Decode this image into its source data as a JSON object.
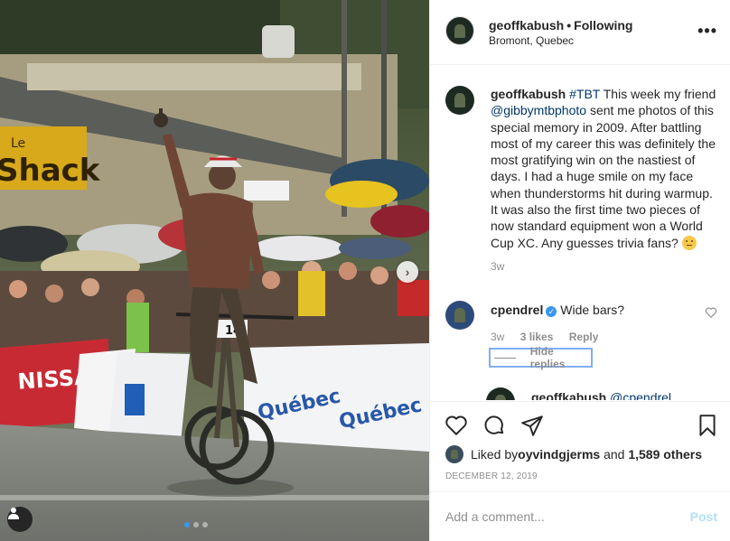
{
  "post": {
    "username": "geoffkabush",
    "follow_sep": "•",
    "follow_label": "Following",
    "location": "Bromont, Quebec",
    "more_icon": "more-horizontal-icon",
    "photo_signs": {
      "shack": "Shack",
      "le": "Le",
      "nissan": "NISSAN",
      "bike_number": "14",
      "quebec": "Québec"
    }
  },
  "caption": {
    "username": "geoffkabush",
    "hashtag": "#TBT",
    "text_1": " This week my friend ",
    "mention": "@gibbymtbphoto",
    "text_2": " sent me photos of this special memory in 2009. After battling most of my career this was definitely the most gratifying win on the nastiest of days. I had a huge smile on my face when thunderstorms hit during warmup. It was also the first time two pieces of now standard equipment won a World Cup XC. Any guesses trivia fans? ",
    "emoji": "thinking-face-emoji",
    "age": "3w"
  },
  "comments": [
    {
      "username": "cpendrel",
      "verified": true,
      "text": "Wide bars?",
      "age": "3w",
      "likes": "3 likes",
      "reply": "Reply",
      "hide_replies": "Hide replies"
    },
    {
      "username": "geoffkabush",
      "mention": "@cpendrel"
    }
  ],
  "actions": {
    "liked_by_prefix": "Liked by ",
    "liked_by_user": "oyvindgjerms",
    "liked_and": " and ",
    "liked_count": "1,589 others",
    "date": "DECEMBER 12, 2019"
  },
  "add_comment": {
    "placeholder": "Add a comment...",
    "post_label": "Post"
  },
  "carousel": {
    "slide_count": 3,
    "active_index": 0
  },
  "colors": {
    "link": "#00376b",
    "verified": "#3897f0",
    "post_disabled": "#b2dffc",
    "muted": "#8e8e8e"
  }
}
